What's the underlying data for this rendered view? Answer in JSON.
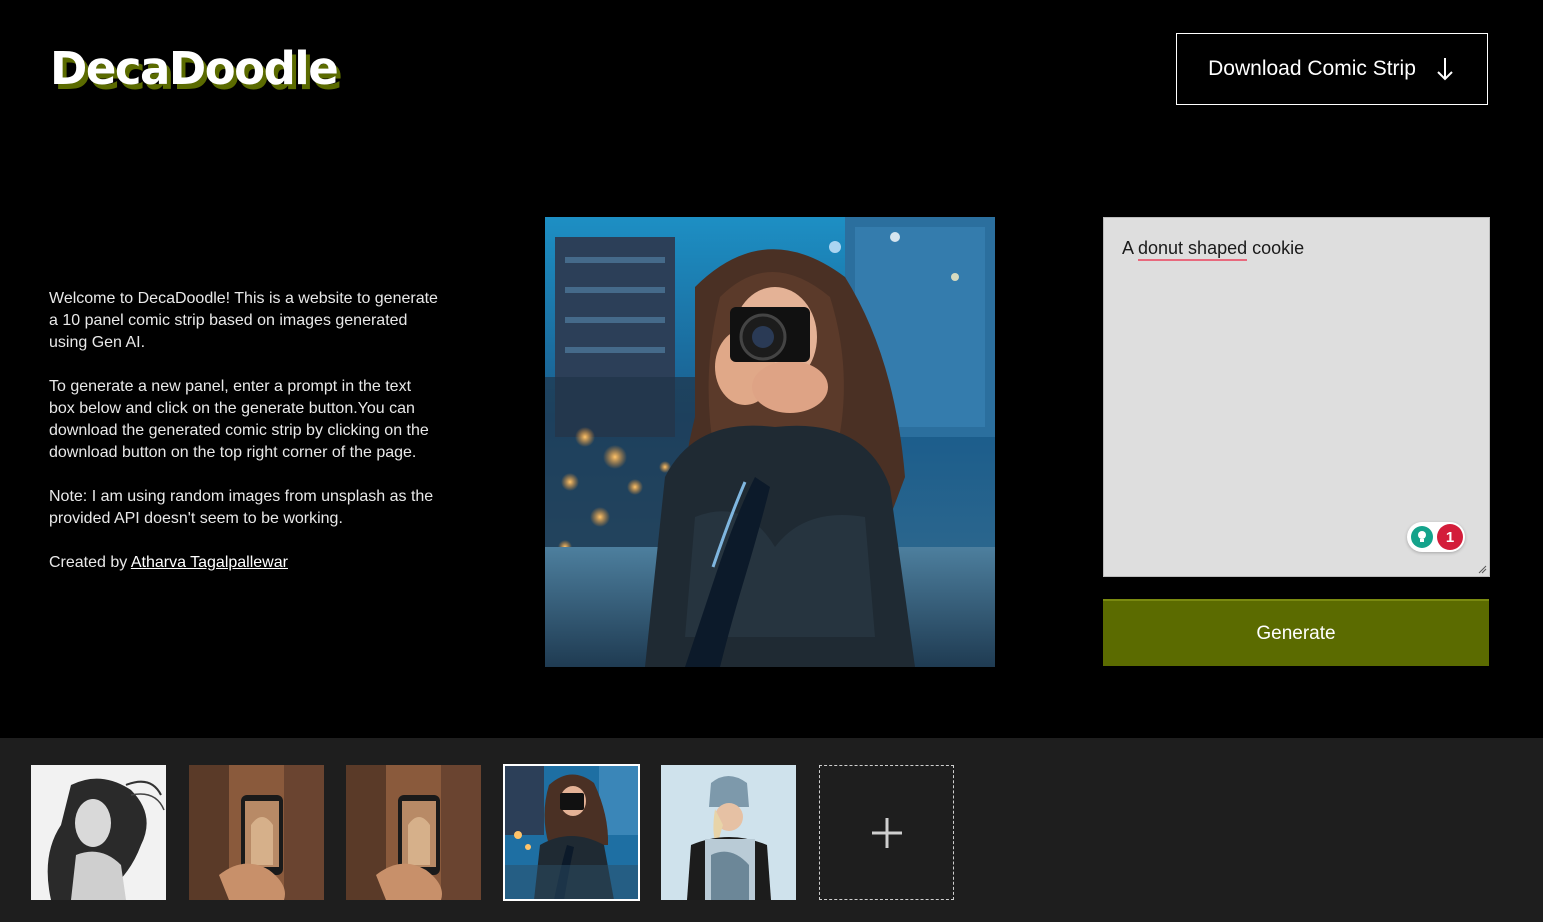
{
  "header": {
    "logo": "DecaDoodle",
    "download_label": "Download Comic Strip",
    "download_icon": "arrow-down-icon"
  },
  "intro": {
    "paragraph_1": "Welcome to DecaDoodle! This is a website to generate a 10 panel comic strip based on images generated using Gen AI.",
    "paragraph_2": "To generate a new panel, enter a prompt in the text box below and click on the generate button.You can download the generated comic strip by clicking on the download button on the top right corner of the page.",
    "paragraph_3": "Note: I am using random images from unsplash as the provided API doesn't seem to be working.",
    "credit_prefix": "Created by ",
    "credit_name": "Atharva Tagalpallewar"
  },
  "prompt": {
    "word_1": "A ",
    "word_spell": "donut shaped",
    "word_rest": " cookie",
    "grammar_count": "1"
  },
  "generate_label": "Generate",
  "colors": {
    "accent": "#5b6b00",
    "background": "#000000",
    "strip_background": "#1e1e1e",
    "textarea_bg": "#dedede"
  },
  "panels": {
    "selected_index": 3,
    "items": [
      {
        "subject": "woman with flowing hair, black and white sketch"
      },
      {
        "subject": "hand holding phone in archway"
      },
      {
        "subject": "hand holding phone in archway"
      },
      {
        "subject": "woman photographing with camera on city rooftop"
      },
      {
        "subject": "woman in beanie holding magazine"
      }
    ],
    "add_icon": "plus-icon"
  }
}
